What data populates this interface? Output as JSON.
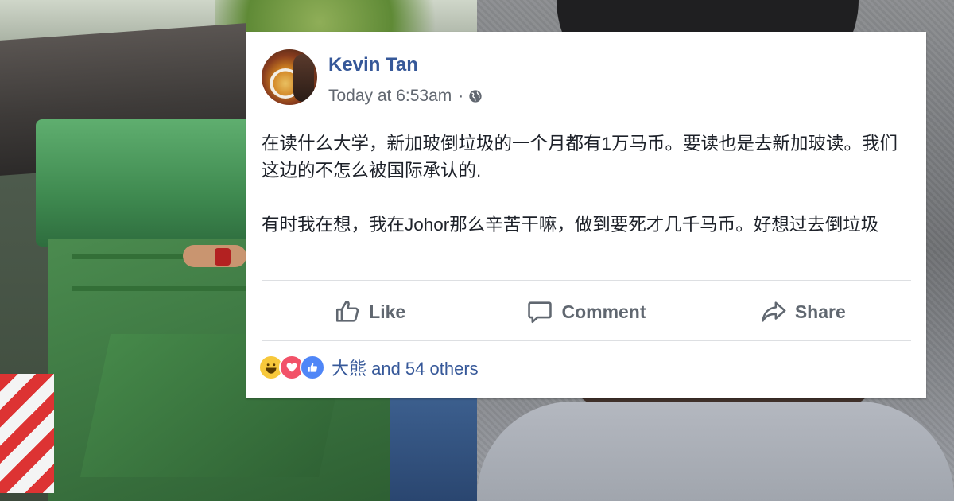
{
  "post": {
    "author": "Kevin Tan",
    "timestamp": "Today at 6:53am",
    "separator": "·",
    "privacy_icon": "globe-icon",
    "paragraph1": "在读什么大学，新加玻倒垃圾的一个月都有1万马币。要读也是去新加玻读。我们这边的不怎么被国际承认的.",
    "paragraph2": "有时我在想，我在Johor那么辛苦干嘛，做到要死才几千马币。好想过去倒垃圾"
  },
  "actions": {
    "like_label": "Like",
    "comment_label": "Comment",
    "share_label": "Share"
  },
  "reactions": {
    "icons": [
      "haha-icon",
      "love-icon",
      "like-icon"
    ],
    "summary": "大熊 and 54 others"
  },
  "colors": {
    "link_blue": "#365899",
    "action_gray": "#606770",
    "meta_gray": "#616770",
    "text": "#1d2129",
    "divider": "#dddfe2"
  }
}
